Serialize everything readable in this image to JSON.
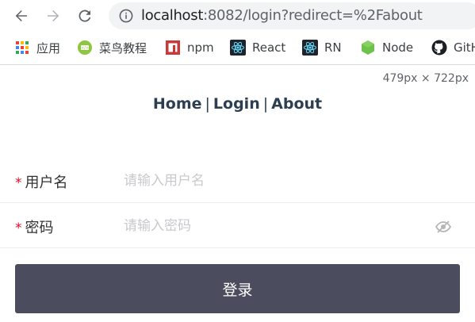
{
  "browser": {
    "url_host": "localhost",
    "url_rest": ":8082/login?redirect=%2Fabout",
    "back_icon": "arrow-left-icon",
    "forward_icon": "arrow-right-icon",
    "reload_icon": "reload-icon",
    "info_icon": "info-icon"
  },
  "bookmarks": [
    {
      "label": "应用",
      "icon": "apps-grid-icon"
    },
    {
      "label": "菜鸟教程",
      "icon": "runoob-icon"
    },
    {
      "label": "npm",
      "icon": "npm-icon"
    },
    {
      "label": "React",
      "icon": "react-icon"
    },
    {
      "label": "RN",
      "icon": "react-native-icon"
    },
    {
      "label": "Node",
      "icon": "nodejs-icon"
    },
    {
      "label": "GitH",
      "icon": "github-icon"
    }
  ],
  "viewport_readout": "479px × 722px",
  "nav": {
    "home": "Home",
    "login": "Login",
    "about": "About",
    "separator": "|"
  },
  "form": {
    "required_mark": "*",
    "username_label": "用户名",
    "username_placeholder": "请输入用户名",
    "username_value": "",
    "password_label": "密码",
    "password_placeholder": "请输入密码",
    "password_value": "",
    "password_toggle_icon": "eye-closed-icon",
    "submit_label": "登录"
  },
  "colors": {
    "nav_text": "#2c3e50",
    "required": "#ee0a24",
    "button_bg": "#4b4c5d",
    "placeholder": "#c8c9cc"
  }
}
